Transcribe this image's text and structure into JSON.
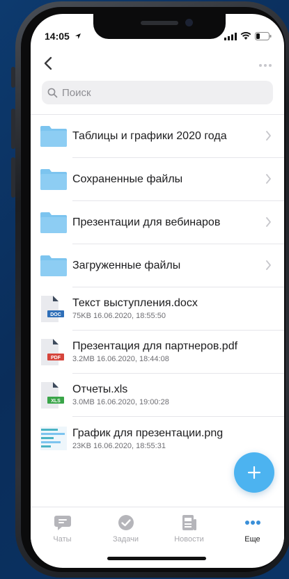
{
  "status": {
    "time": "14:05"
  },
  "search": {
    "placeholder": "Поиск"
  },
  "files": [
    {
      "type": "folder",
      "name": "Таблицы и графики 2020 года"
    },
    {
      "type": "folder",
      "name": "Сохраненные файлы"
    },
    {
      "type": "folder",
      "name": "Презентации для вебинаров"
    },
    {
      "type": "folder",
      "name": "Загруженные файлы"
    },
    {
      "type": "file",
      "badge": "DOC",
      "badge_color": "#2f6fb8",
      "name": "Текст выступления.docx",
      "meta": "75KB 16.06.2020, 18:55:50"
    },
    {
      "type": "file",
      "badge": "PDF",
      "badge_color": "#d6453c",
      "name": "Презентация для партнеров.pdf",
      "meta": "3.2MB 16.06.2020, 18:44:08"
    },
    {
      "type": "file",
      "badge": "XLS",
      "badge_color": "#3aa549",
      "name": "Отчеты.xls",
      "meta": "3.0MB 16.06.2020, 19:00:28"
    },
    {
      "type": "image",
      "name": "График для презентации.png",
      "meta": "23KB 16.06.2020, 18:55:31"
    }
  ],
  "tabs": [
    {
      "label": "Чаты",
      "icon": "chat-icon"
    },
    {
      "label": "Задачи",
      "icon": "check-icon"
    },
    {
      "label": "Новости",
      "icon": "news-icon"
    },
    {
      "label": "Еще",
      "icon": "more-icon",
      "active": true
    }
  ],
  "colors": {
    "accent": "#4cb3f0",
    "folder": "#7cc4ef"
  }
}
